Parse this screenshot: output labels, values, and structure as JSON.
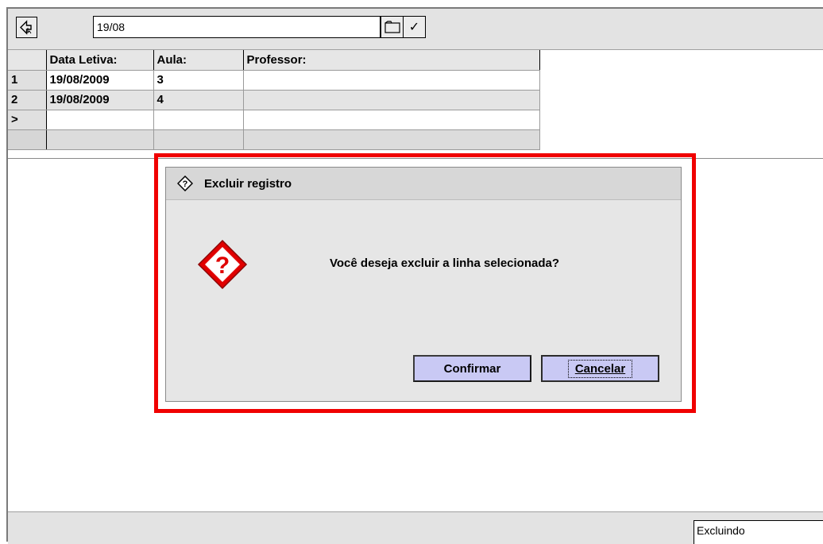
{
  "toolbar": {
    "nav_icon": "back-arrow-icon",
    "date_value": "19/08",
    "calendar_icon": "calendar-icon",
    "check_label": "✓"
  },
  "grid": {
    "columns": [
      "",
      "Data Letiva:",
      "Aula:",
      "Professor:"
    ],
    "rows": [
      {
        "header": "1",
        "data_letiva": "19/08/2009",
        "aula": "3",
        "professor": ""
      },
      {
        "header": "2",
        "data_letiva": "19/08/2009",
        "aula": "4",
        "professor": ""
      },
      {
        "header": ">",
        "data_letiva": "",
        "aula": "",
        "professor": ""
      }
    ]
  },
  "dialog": {
    "title": "Excluir registro",
    "message": "Você deseja excluir a linha selecionada?",
    "icon": "question-warning-icon",
    "confirm_label": "Confirmar",
    "cancel_label": "Cancelar"
  },
  "status": {
    "mode": "Excluindo"
  },
  "colors": {
    "highlight": "#f00000",
    "button_bg": "#c9c9f4",
    "icon_red": "#e00000"
  }
}
